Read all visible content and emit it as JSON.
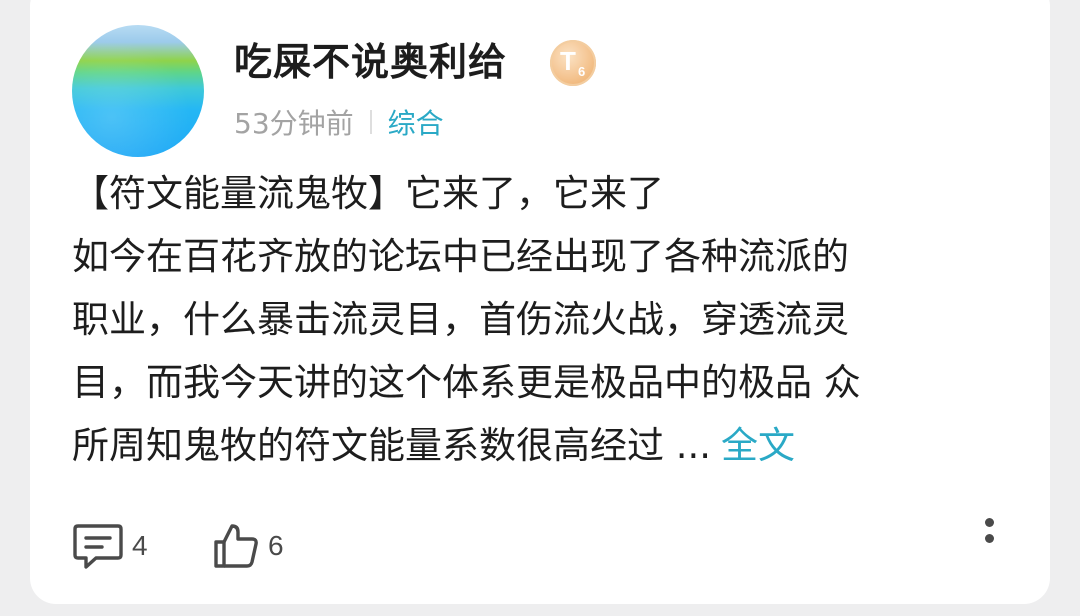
{
  "post": {
    "author": {
      "name": "吃屎不说奥利给",
      "badge": {
        "letter": "T",
        "level": "6"
      }
    },
    "time": "53分钟前",
    "category": "综合",
    "content_lines": [
      "【符文能量流鬼牧】它来了，它来了",
      "如今在百花齐放的论坛中已经出现了各种流派的",
      "职业，什么暴击流灵目，首伤流火战，穿透流灵",
      "目，而我今天讲的这个体系更是极品中的极品 众",
      "所周知鬼牧的符文能量系数很高经过 ..."
    ],
    "full_text_label": "全文",
    "stats": {
      "comments": "4",
      "likes": "6"
    }
  },
  "icons": {
    "comment": "comment-icon",
    "like": "thumbs-up-icon",
    "more": "more-vertical-icon"
  },
  "colors": {
    "accent": "#2aa9c6",
    "text": "#1d1d1d",
    "meta": "#a3a3a3",
    "background": "#eeeeef",
    "card": "#ffffff"
  }
}
